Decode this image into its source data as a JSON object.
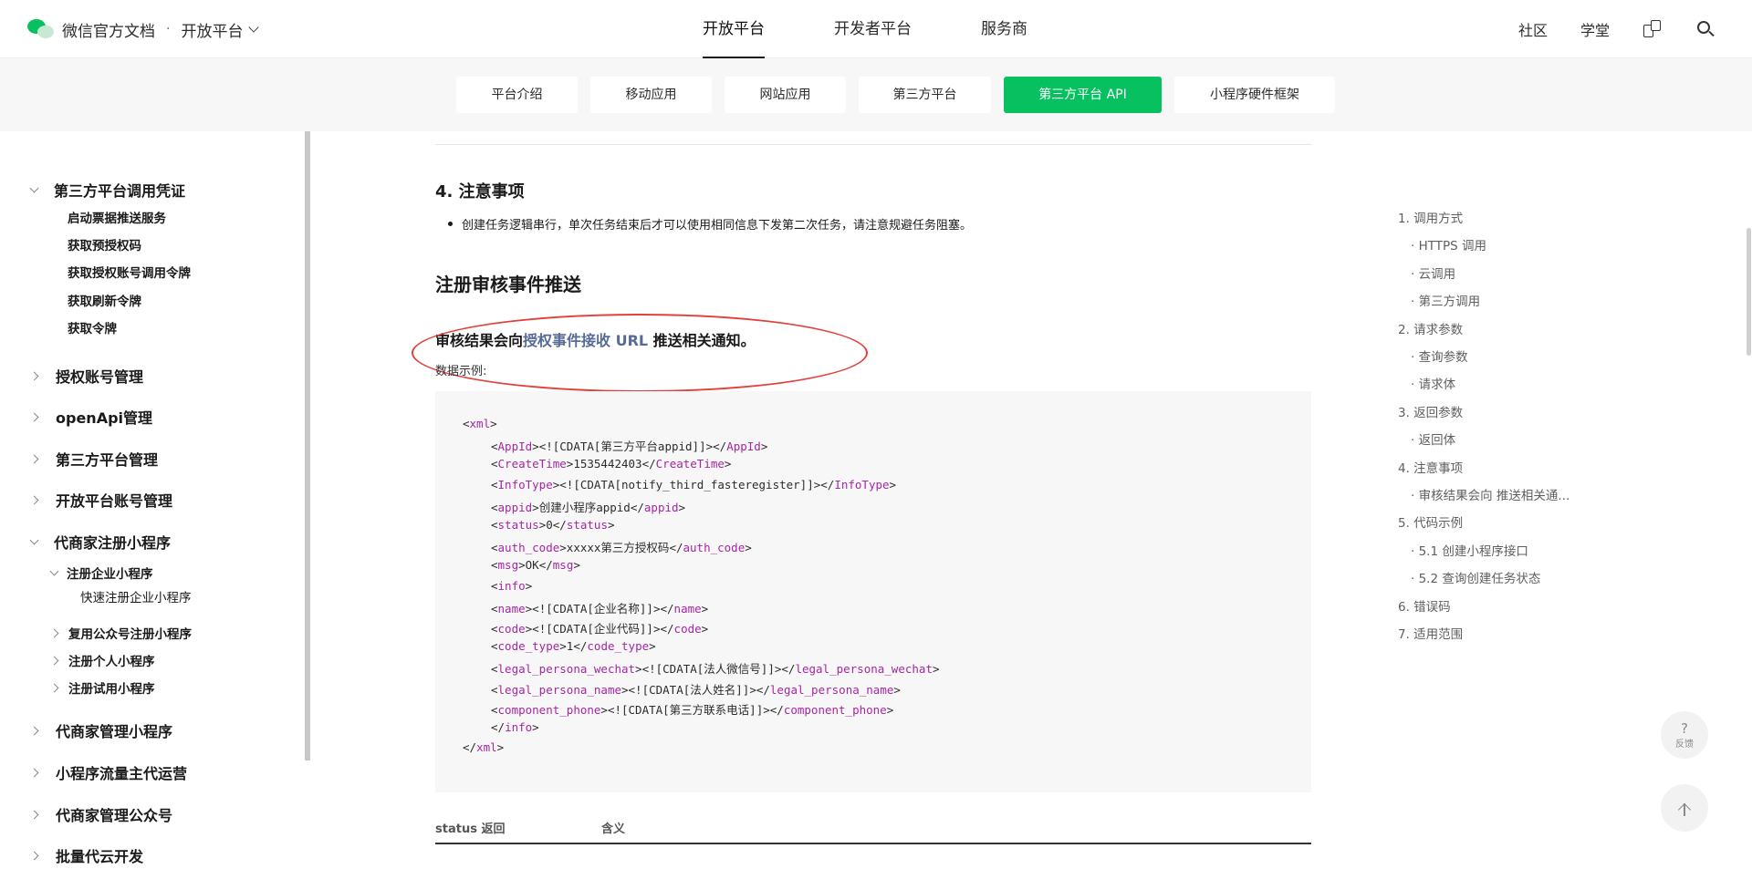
{
  "header": {
    "logo_title": "微信官方文档",
    "separator": "·",
    "platform_selector": "开放平台",
    "nav": [
      {
        "label": "开放平台",
        "active": true
      },
      {
        "label": "开发者平台",
        "active": false
      },
      {
        "label": "服务商",
        "active": false
      }
    ],
    "links": [
      "社区",
      "学堂"
    ]
  },
  "subnav": {
    "tabs": [
      {
        "label": "平台介绍",
        "active": false
      },
      {
        "label": "移动应用",
        "active": false
      },
      {
        "label": "网站应用",
        "active": false
      },
      {
        "label": "第三方平台",
        "active": false
      },
      {
        "label": "第三方平台 API",
        "active": true
      },
      {
        "label": "小程序硬件框架",
        "active": false
      }
    ],
    "accent": "#07c160"
  },
  "sidebar": {
    "items": [
      {
        "label": "第三方平台调用凭证",
        "level": 1,
        "expanded": true
      },
      {
        "label": "启动票据推送服务",
        "level": 2
      },
      {
        "label": "获取预授权码",
        "level": 2
      },
      {
        "label": "获取授权账号调用令牌",
        "level": 2
      },
      {
        "label": "获取刷新令牌",
        "level": 2
      },
      {
        "label": "获取令牌",
        "level": 2
      },
      {
        "label": "授权账号管理",
        "level": 1,
        "expanded": false
      },
      {
        "label": "openApi管理",
        "level": 1,
        "expanded": false
      },
      {
        "label": "第三方平台管理",
        "level": 1,
        "expanded": false
      },
      {
        "label": "开放平台账号管理",
        "level": 1,
        "expanded": false
      },
      {
        "label": "代商家注册小程序",
        "level": 1,
        "expanded": true
      },
      {
        "label": "注册企业小程序",
        "level": 2,
        "expanded": true
      },
      {
        "label": "快速注册企业小程序",
        "level": 3
      },
      {
        "label": "复用公众号注册小程序",
        "level": 2,
        "expanded": false
      },
      {
        "label": "注册个人小程序",
        "level": 2,
        "expanded": false
      },
      {
        "label": "注册试用小程序",
        "level": 2,
        "expanded": false
      },
      {
        "label": "代商家管理小程序",
        "level": 1,
        "expanded": false
      },
      {
        "label": "小程序流量主代运营",
        "level": 1,
        "expanded": false
      },
      {
        "label": "代商家管理公众号",
        "level": 1,
        "expanded": false
      },
      {
        "label": "批量代云开发",
        "level": 1,
        "expanded": false
      }
    ]
  },
  "content": {
    "section_heading": "4. 注意事项",
    "bullet": "创建任务逻辑串行，单次任务结束后才可以使用相同信息下发第二次任务，请注意规避任务阻塞。",
    "heading": "注册审核事件推送",
    "para_prefix": "审核结果会向",
    "para_link": "授权事件接收 URL",
    "para_suffix": " 推送相关通知。",
    "example_label": "数据示例:",
    "code_lines": [
      {
        "indent": 0,
        "open": "xml",
        "value": "",
        "close": ""
      },
      {
        "indent": 1,
        "open": "AppId",
        "value": "<![CDATA[第三方平台appid]]>",
        "close": "AppId"
      },
      {
        "indent": 1,
        "open": "CreateTime",
        "value": "1535442403",
        "close": "CreateTime"
      },
      {
        "indent": 1,
        "open": "InfoType",
        "value": "<![CDATA[notify_third_fasteregister]]>",
        "close": "InfoType"
      },
      {
        "indent": 1,
        "open": "appid",
        "value": "创建小程序appid",
        "close": "appid"
      },
      {
        "indent": 1,
        "open": "status",
        "value": "0",
        "close": "status"
      },
      {
        "indent": 1,
        "open": "auth_code",
        "value": "xxxxx第三方授权码",
        "close": "auth_code"
      },
      {
        "indent": 1,
        "open": "msg",
        "value": "OK",
        "close": "msg"
      },
      {
        "indent": 1,
        "open": "info",
        "value": "",
        "close": ""
      },
      {
        "indent": 1,
        "open": "name",
        "value": "<![CDATA[企业名称]]>",
        "close": "name"
      },
      {
        "indent": 1,
        "open": "code",
        "value": "<![CDATA[企业代码]]>",
        "close": "code"
      },
      {
        "indent": 1,
        "open": "code_type",
        "value": "1",
        "close": "code_type"
      },
      {
        "indent": 1,
        "open": "legal_persona_wechat",
        "value": "<![CDATA[法人微信号]]>",
        "close": "legal_persona_wechat"
      },
      {
        "indent": 1,
        "open": "legal_persona_name",
        "value": "<![CDATA[法人姓名]]>",
        "close": "legal_persona_name"
      },
      {
        "indent": 1,
        "open": "component_phone",
        "value": "<![CDATA[第三方联系电话]]>",
        "close": "component_phone"
      },
      {
        "indent": 1,
        "open": "",
        "value": "",
        "close": "info"
      },
      {
        "indent": 0,
        "open": "",
        "value": "",
        "close": "xml"
      }
    ],
    "table_headers": [
      "status 返回",
      "含义"
    ]
  },
  "toc": {
    "items": [
      {
        "label": "1. 调用方式",
        "level": 1
      },
      {
        "label": "· HTTPS 调用",
        "level": 2
      },
      {
        "label": "· 云调用",
        "level": 2
      },
      {
        "label": "· 第三方调用",
        "level": 2
      },
      {
        "label": "2. 请求参数",
        "level": 1
      },
      {
        "label": "· 查询参数",
        "level": 2
      },
      {
        "label": "· 请求体",
        "level": 2
      },
      {
        "label": "3. 返回参数",
        "level": 1
      },
      {
        "label": "· 返回体",
        "level": 2
      },
      {
        "label": "4. 注意事项",
        "level": 1
      },
      {
        "label": "· 审核结果会向 推送相关通...",
        "level": 2
      },
      {
        "label": "5. 代码示例",
        "level": 1
      },
      {
        "label": "· 5.1 创建小程序接口",
        "level": 2
      },
      {
        "label": "· 5.2 查询创建任务状态",
        "level": 2
      },
      {
        "label": "6. 错误码",
        "level": 1
      },
      {
        "label": "7. 适用范围",
        "level": 1
      }
    ]
  },
  "feedback": {
    "icon": "?",
    "label": "反馈"
  }
}
